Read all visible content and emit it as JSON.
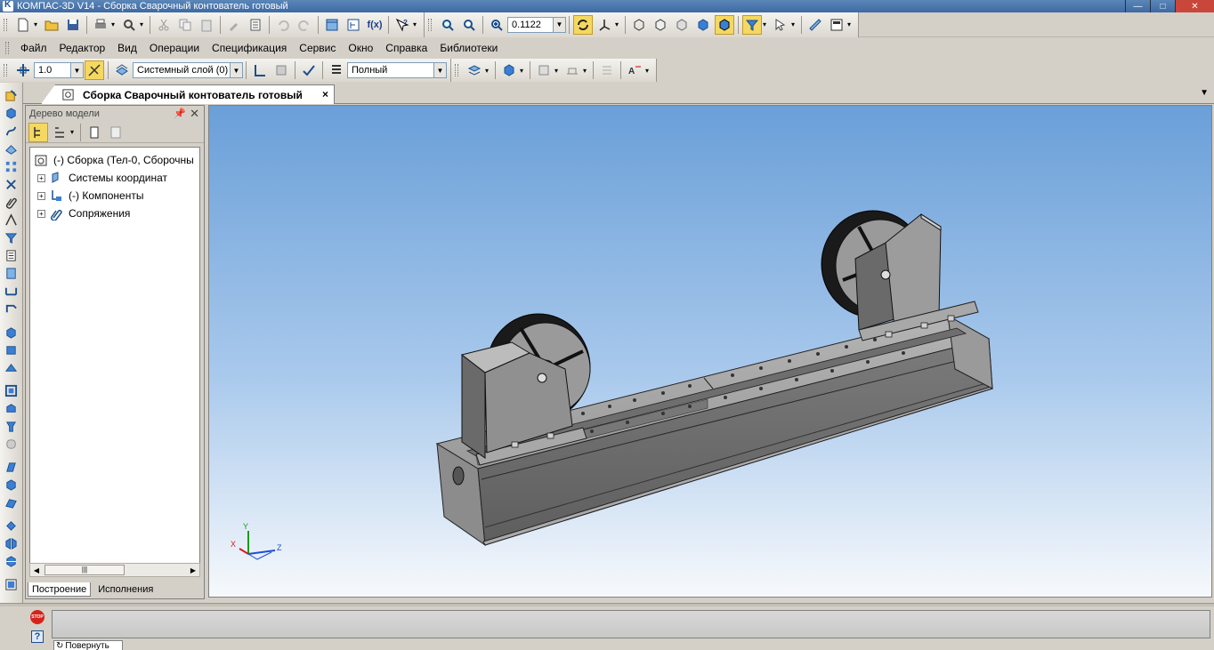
{
  "window": {
    "title": "КОМПАС-3D V14 - Сборка Сварочный контователь готовый",
    "minimize": "—",
    "maximize": "□",
    "close": "✕"
  },
  "toolbar": {
    "zoom_value": "0.1122",
    "step_value": "1.0",
    "layer_value": "Системный слой (0)",
    "view_mode_value": "Полный",
    "formula_label": "f(x)"
  },
  "menu": {
    "items": [
      "Файл",
      "Редактор",
      "Вид",
      "Операции",
      "Спецификация",
      "Сервис",
      "Окно",
      "Справка",
      "Библиотеки"
    ]
  },
  "document": {
    "tab_title": "Сборка Сварочный контователь готовый",
    "tab_close": "×"
  },
  "tree": {
    "header": "Дерево модели",
    "root_label": "(-) Сборка (Тел-0, Сборочны",
    "nodes": [
      {
        "label": "Системы координат",
        "icon": "coordinate-system-icon"
      },
      {
        "label": "(-) Компоненты",
        "icon": "components-icon"
      },
      {
        "label": "Сопряжения",
        "icon": "mates-icon"
      }
    ],
    "tabs": [
      "Построение",
      "Исполнения"
    ]
  },
  "axes": {
    "x": "X",
    "y": "Y",
    "z": "Z"
  },
  "bottom": {
    "stop_label": "STOP",
    "help_label": "?",
    "rotate_tab": "Повернуть"
  },
  "colors": {
    "titlebar": "#3d6aa3",
    "viewport_top": "#6a9fd8",
    "viewport_bottom": "#f7f9fc",
    "model_gray": "#8f8f8f"
  }
}
